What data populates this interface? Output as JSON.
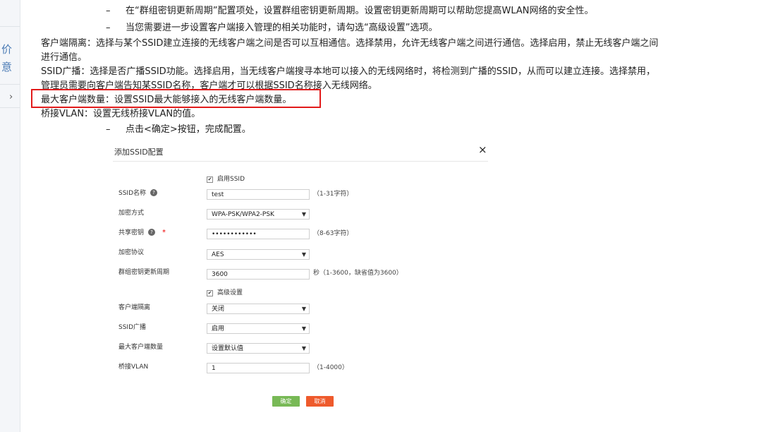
{
  "sidebar": {
    "chars": [
      "价",
      "意"
    ],
    "chevron": "chevron-right-icon"
  },
  "doc": {
    "bullet1": "在“群组密钥更新周期”配置项处，设置群组密钥更新周期。设置密钥更新周期可以帮助您提高WLAN网络的安全性。",
    "bullet2": "当您需要进一步设置客户端接入管理的相关功能时，请勾选“高级设置”选项。",
    "para_isolation_1": "客户端隔离：选择与某个SSID建立连接的无线客户端之间是否可以互相通信。选择禁用，允许无线客户端之间进行通信。选择启用，禁止无线客户端之间",
    "para_isolation_2": "进行通信。",
    "para_broadcast_1": "SSID广播：选择是否广播SSID功能。选择启用，当无线客户端搜寻本地可以接入的无线网络时，将检测到广播的SSID，从而可以建立连接。选择禁用，",
    "para_broadcast_2": "管理员需要向客户端告知某SSID名称，客户端才可以根据SSID名称接入无线网络。",
    "para_max": "最大客户端数量：设置SSID最大能够接入的无线客户端数量。",
    "para_vlan": "桥接VLAN：设置无线桥接VLAN的值。",
    "bullet3": "点击<确定>按钮，完成配置。",
    "dash": "–"
  },
  "dialog": {
    "title": "添加SSID配置",
    "close": "×",
    "enable_ssid": "启用SSID",
    "ssid_name_label": "SSID名称",
    "ssid_name_value": "test",
    "ssid_name_hint": "（1-31字符）",
    "encrypt_label": "加密方式",
    "encrypt_value": "WPA-PSK/WPA2-PSK",
    "psk_label": "共享密钥",
    "psk_required": "*",
    "psk_value": "••••••••••••",
    "psk_hint": "（8-63字符）",
    "cipher_label": "加密协议",
    "cipher_value": "AES",
    "rekey_label": "群组密钥更新周期",
    "rekey_value": "3600",
    "rekey_hint": "秒（1-3600，缺省值为3600）",
    "advanced": "高级设置",
    "isolation_label": "客户端隔离",
    "isolation_value": "关闭",
    "broadcast_label": "SSID广播",
    "broadcast_value": "启用",
    "max_label": "最大客户端数量",
    "max_value": "设置默认值",
    "vlan_label": "桥接VLAN",
    "vlan_value": "1",
    "vlan_hint": "（1-4000）",
    "help_glyph": "?",
    "check_glyph": "✔",
    "caret_glyph": "▼",
    "ok": "确定",
    "cancel": "取消"
  },
  "colors": {
    "highlight": "#e21b1b",
    "ok_button": "#78b956",
    "cancel_button": "#ee5a2c",
    "required": "#ee0000"
  }
}
